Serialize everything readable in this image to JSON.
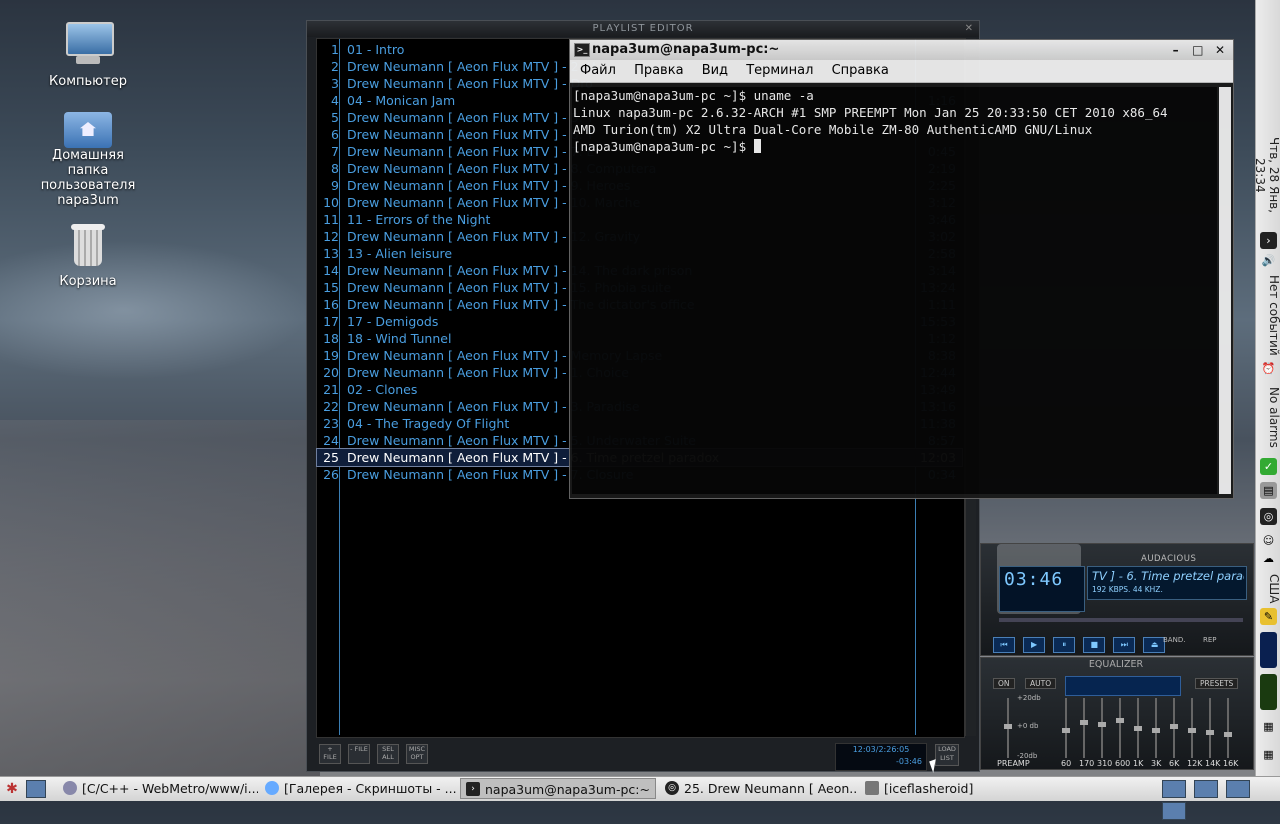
{
  "desktop": {
    "icons": [
      {
        "label": "Компьютер"
      },
      {
        "label": "Домашняя папка пользователя napa3um"
      },
      {
        "label": "Корзина"
      }
    ]
  },
  "playlist": {
    "title": "PLAYLIST EDITOR",
    "tracks": [
      {
        "num": "1",
        "name": "01 - Intro",
        "time": ""
      },
      {
        "num": "2",
        "name": "Drew Neumann [ Aeon Flux MTV ] - 2. U",
        "time": ""
      },
      {
        "num": "3",
        "name": "Drew Neumann [ Aeon Flux MTV ] - Dro",
        "time": ""
      },
      {
        "num": "4",
        "name": "04 - Monican Jam",
        "time": "1:16"
      },
      {
        "num": "5",
        "name": "Drew Neumann [ Aeon Flux MTV ] - 5. T",
        "time": ""
      },
      {
        "num": "6",
        "name": "Drew Neumann [ Aeon Flux MTV ] - 6. T",
        "time": ""
      },
      {
        "num": "7",
        "name": "Drew Neumann [ Aeon Flux MTV ] - 7. E",
        "time": "0:45"
      },
      {
        "num": "8",
        "name": "Drew Neumann [ Aeon Flux MTV ] - 8. Computera",
        "time": "2:19"
      },
      {
        "num": "9",
        "name": "Drew Neumann [ Aeon Flux MTV ] - 9. Heroes",
        "time": "2:25"
      },
      {
        "num": "10",
        "name": "Drew Neumann [ Aeon Flux MTV ] - 10. Marche",
        "time": "3:12"
      },
      {
        "num": "11",
        "name": "11 - Errors of the Night",
        "time": "3:46"
      },
      {
        "num": "12",
        "name": "Drew Neumann [ Aeon Flux MTV ] - 12. Gravity",
        "time": "3:02"
      },
      {
        "num": "13",
        "name": "13 - Alien leisure",
        "time": "2:58"
      },
      {
        "num": "14",
        "name": "Drew Neumann [ Aeon Flux MTV ] - 14. The dark prison",
        "time": "3:14"
      },
      {
        "num": "15",
        "name": "Drew Neumann [ Aeon Flux MTV ] - 15. Phobia suite",
        "time": "13:24"
      },
      {
        "num": "16",
        "name": "Drew Neumann [ Aeon Flux MTV ] - The dictator's office",
        "time": "1:11"
      },
      {
        "num": "17",
        "name": "17 - Demigods",
        "time": "15:53"
      },
      {
        "num": "18",
        "name": "18 - Wind Tunnel",
        "time": "1:12"
      },
      {
        "num": "19",
        "name": "Drew Neumann [ Aeon Flux MTV ] - Memory Lapse",
        "time": "8:38"
      },
      {
        "num": "20",
        "name": "Drew Neumann [ Aeon Flux MTV ] - 1. Choice",
        "time": "12:44"
      },
      {
        "num": "21",
        "name": "02 - Clones",
        "time": "13:49"
      },
      {
        "num": "22",
        "name": "Drew Neumann [ Aeon Flux MTV ] - 3. Paradise",
        "time": "13:16"
      },
      {
        "num": "23",
        "name": "04 - The Tragedy Of Flight",
        "time": "11:38"
      },
      {
        "num": "24",
        "name": "Drew Neumann [ Aeon Flux MTV ] - 5. Underwater Suite",
        "time": "8:57"
      },
      {
        "num": "25",
        "name": "Drew Neumann [ Aeon Flux MTV ] - 6. Time pretzel paradox",
        "time": "12:03"
      },
      {
        "num": "26",
        "name": "Drew Neumann [ Aeon Flux MTV ] - 7. Closure",
        "time": "0:34"
      }
    ],
    "selected_index": 24,
    "buttons": [
      "+ FILE",
      "- FILE",
      "SEL ALL",
      "MISC OPT"
    ],
    "info_total": "12:03/2:26:05",
    "info_remaining": "-03:46",
    "load_list": "LOAD LIST"
  },
  "terminal": {
    "title": "napa3um@napa3um-pc:~",
    "menu": [
      "Файл",
      "Правка",
      "Вид",
      "Терминал",
      "Справка"
    ],
    "lines": [
      "[napa3um@napa3um-pc ~]$ uname -a",
      "Linux napa3um-pc 2.6.32-ARCH #1 SMP PREEMPT Mon Jan 25 20:33:50 CET 2010 x86_64",
      "AMD Turion(tm) X2 Ultra Dual-Core Mobile ZM-80 AuthenticAMD GNU/Linux",
      "[napa3um@napa3um-pc ~]$ "
    ]
  },
  "player": {
    "name": "AUDACIOUS",
    "time": "03:46",
    "song": "TV ] - 6. Time pretzel paradox",
    "bitrate": "192 KBPS. 44 KHZ.",
    "band": "BAND.",
    "rep": "REP"
  },
  "equalizer": {
    "title": "EQUALIZER",
    "on": "ON",
    "auto": "AUTO",
    "presets": "PRESETS",
    "db_top": "+20db",
    "db_mid": "+0 db",
    "db_bot": "-20db",
    "preamp": "PREAMP",
    "bands": [
      "60",
      "170",
      "310",
      "600",
      "1K",
      "3K",
      "6K",
      "12K",
      "14K",
      "16K"
    ]
  },
  "side_panel": {
    "clock": "Чтв, 28 Янв, 23:34",
    "events": "Нет событий",
    "alarms": "No alarms",
    "layout": "США"
  },
  "taskbar": {
    "tasks": [
      {
        "label": "[C/C++ - WebMetro/www/i..."
      },
      {
        "label": "[Галерея - Скриншоты - ..."
      },
      {
        "label": "napa3um@napa3um-pc:~"
      },
      {
        "label": "25. Drew Neumann [ Aeon..."
      },
      {
        "label": "[iceflasheroid]"
      }
    ],
    "active_index": 2
  }
}
